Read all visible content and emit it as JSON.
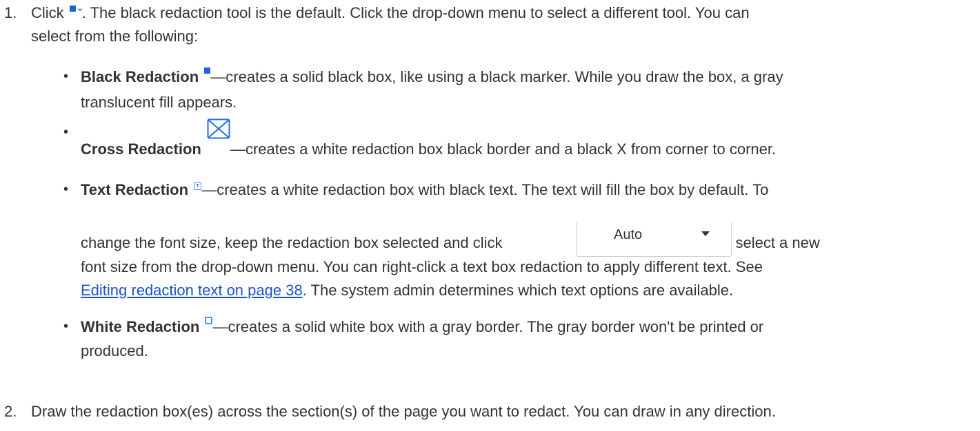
{
  "steps": [
    {
      "num": "1.",
      "line1_a": "Click ",
      "line1_b": ". The black redaction tool is the default. Click the drop-down menu to select a different tool. You can",
      "line2": "select from the following:",
      "icon": "blue-square-dropdown-icon"
    },
    {
      "num": "2.",
      "text": "Draw the redaction box(es) across the section(s) of the page you want to redact. You can draw in any direction."
    }
  ],
  "bullets": {
    "black": {
      "title": "Black Redaction",
      "desc1": "—creates a solid black box, like using a black marker. While you draw the box, a gray",
      "desc2": "translucent fill appears.",
      "icon": "black-redaction-icon"
    },
    "cross": {
      "title": "Cross Redaction",
      "desc": "—creates a white redaction box black border and a black X from corner to corner.",
      "icon": "cross-redaction-icon"
    },
    "text": {
      "title": "Text Redaction",
      "desc1": "—creates a white redaction box with black text. The text will fill the box by default. To",
      "desc2a": "change the font size, keep the redaction box selected and click",
      "desc2b": ", and then select a new",
      "desc3": "font size from the drop-down menu. You can right-click a text box redaction to apply different text. See",
      "link": "Editing redaction text on page 38",
      "desc4": ". The system admin determines which text options are available.",
      "icon": "text-redaction-icon",
      "icon_letter": "T"
    },
    "white": {
      "title": "White Redaction",
      "desc1": "—creates a solid white box with a gray border. The gray border won't be printed or",
      "desc2": "produced.",
      "icon": "white-redaction-icon"
    }
  },
  "font_size_select": {
    "value": "Auto",
    "icon": "caret-down-icon"
  },
  "colors": {
    "accent": "#1565e0",
    "link": "#1a53c8",
    "text": "#333333"
  }
}
